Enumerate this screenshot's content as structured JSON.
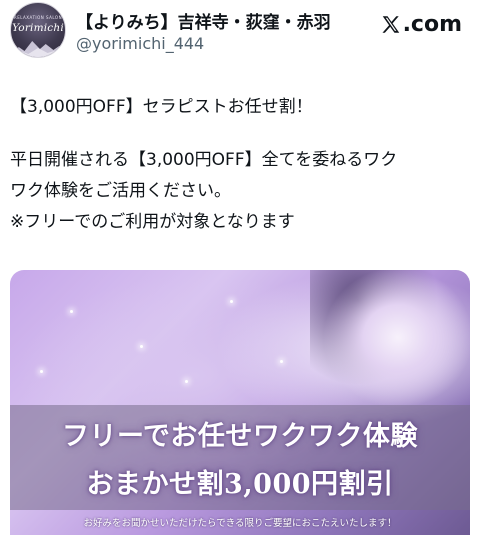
{
  "account": {
    "display_name": "【よりみち】吉祥寺・荻窪・赤羽",
    "handle": "@yorimichi_444",
    "avatar_wordmark": "Yorimichi",
    "avatar_small_text": "RELAXATION SALON"
  },
  "brand": {
    "logo_label": ".com",
    "logo_icon": "x-logo-icon"
  },
  "tweet": {
    "line1": "【3,000円OFF】セラピストお任せ割！",
    "line2": "平日開催される【3,000円OFF】全てを委ねるワク",
    "line3": "ワク体験をご活用ください。",
    "line4": "※フリーでのご利用が対象となります"
  },
  "promo": {
    "headline1": "フリーでお任せワクワク体験",
    "headline2": "おまかせ割3,000円割引",
    "tagline": "お好みをお聞かせいただけたらできる限りご要望におこたえいたします！"
  },
  "colors": {
    "text": "#0f1419",
    "secondary_text": "#536471",
    "promo_purple": "#b999df"
  }
}
